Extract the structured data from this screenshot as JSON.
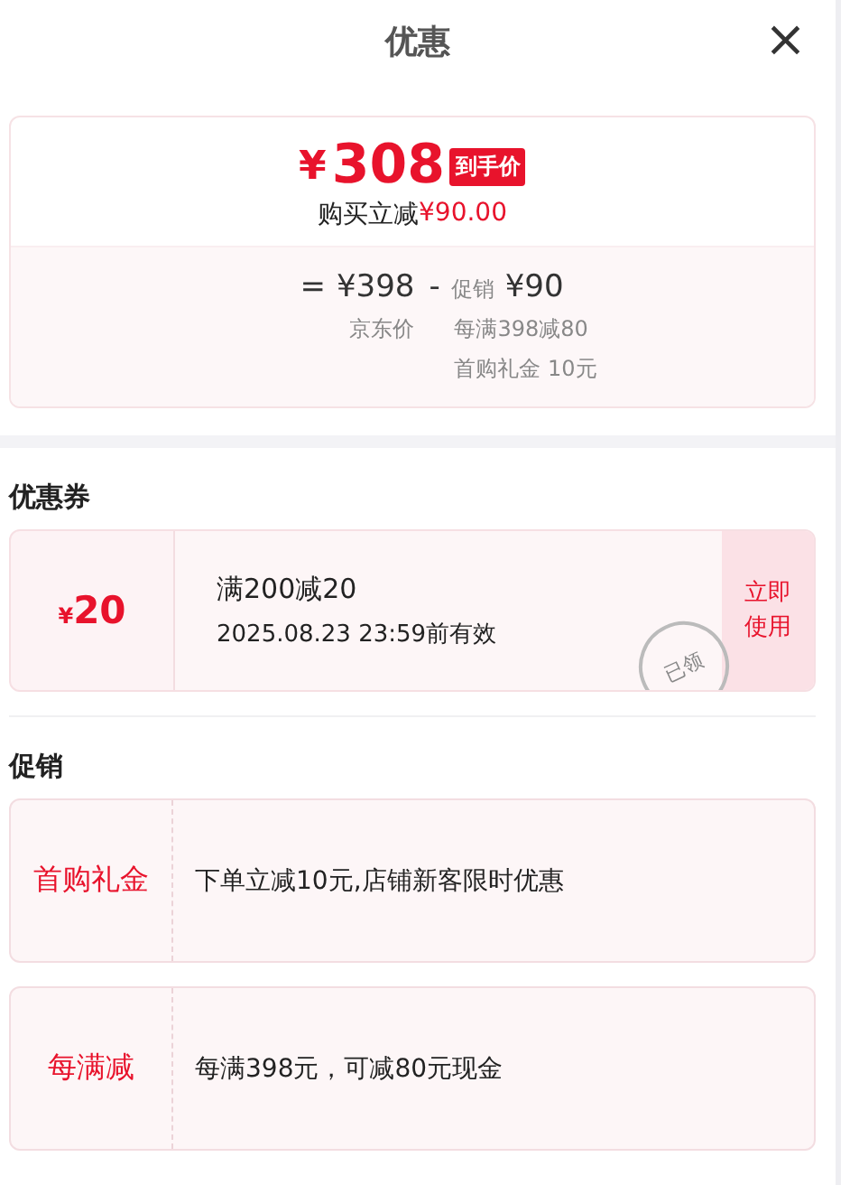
{
  "header": {
    "title": "优惠",
    "close": "×"
  },
  "price_card": {
    "currency": "¥",
    "final_price": "308",
    "badge": "到手价",
    "saving_label": "购买立减",
    "saving_amount": "¥90.00",
    "breakdown": {
      "equals": "=",
      "base_price": "¥398",
      "base_label": "京东价",
      "minus": "-",
      "promo_label": "促销",
      "promo_amount": "¥90",
      "promo_items": [
        "每满398减80",
        "首购礼金 10元"
      ]
    }
  },
  "coupon_section": {
    "heading": "优惠券",
    "coupons": [
      {
        "currency": "¥",
        "amount": "20",
        "condition": "满200减20",
        "validity": "2025.08.23 23:59前有效",
        "claimed": true,
        "stamp": "已领",
        "action": "立即使用"
      }
    ]
  },
  "promo_section": {
    "heading": "促销",
    "promotions": [
      {
        "tag": "首购礼金",
        "description": "下单立减10元,店铺新客限时优惠"
      },
      {
        "tag": "每满减",
        "description": "每满398元，可减80元现金"
      }
    ]
  }
}
